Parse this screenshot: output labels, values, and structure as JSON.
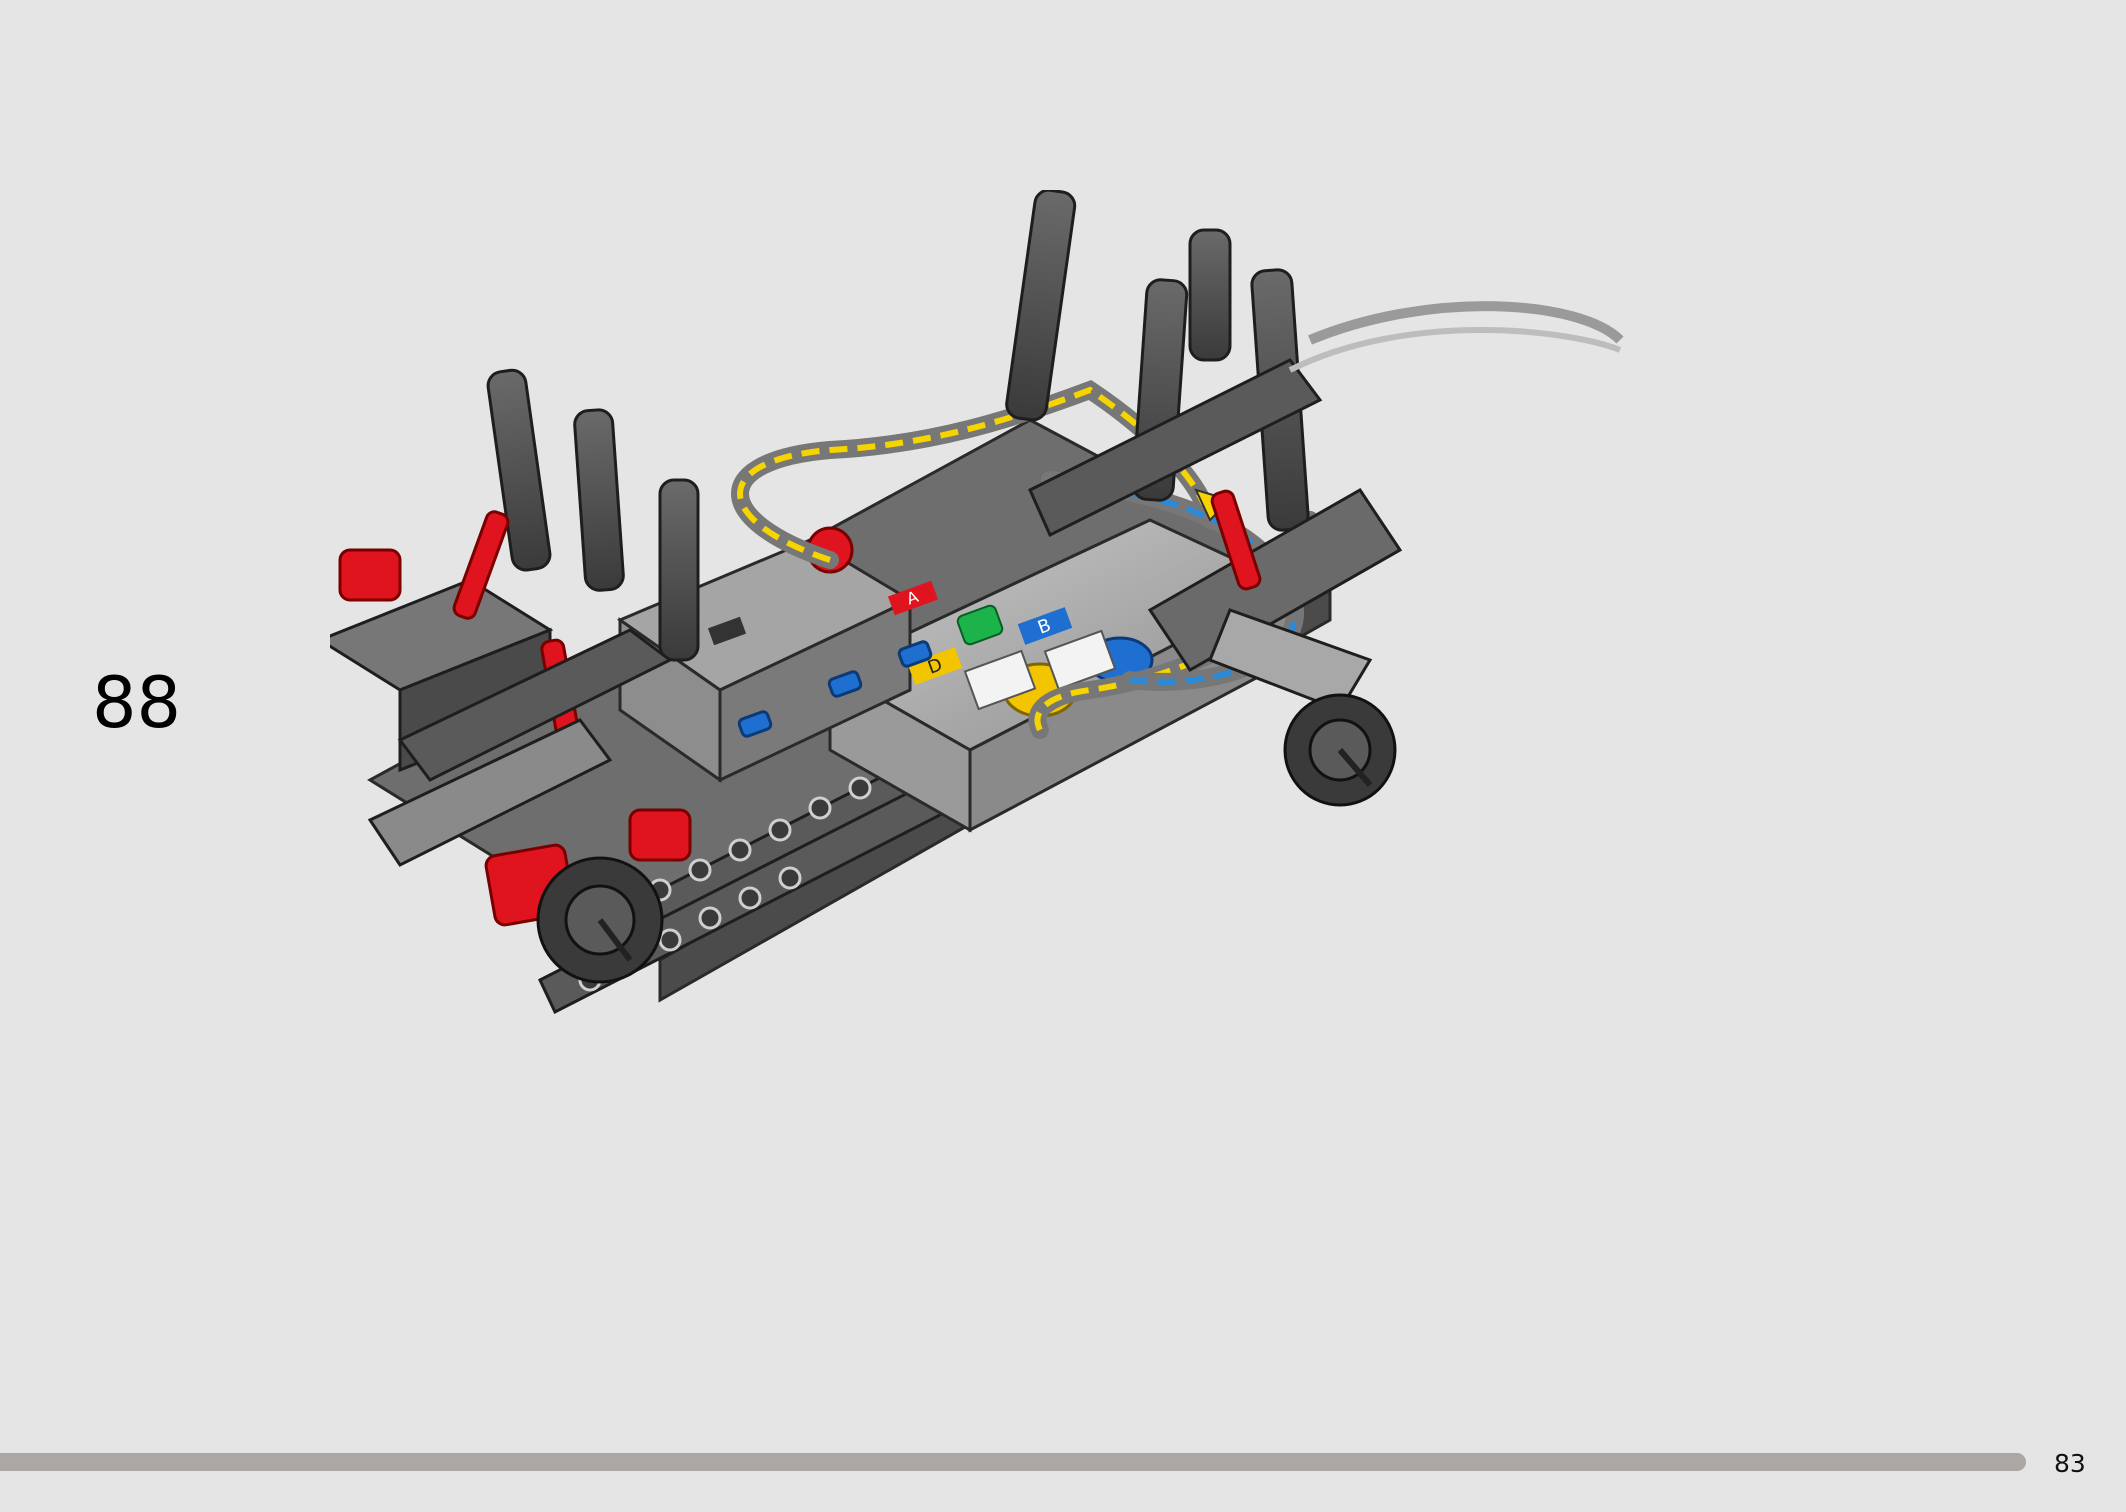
{
  "step": {
    "number": "88"
  },
  "page": {
    "number": "83",
    "progress": 0.976
  },
  "illustration": {
    "subject": "technic-chassis-assembly",
    "hub_port_labels": [
      "A",
      "B",
      "D"
    ],
    "colors": {
      "frame_dark": "#4a4a4a",
      "frame_medium": "#7d7d7d",
      "hub_body": "#a9a9a9",
      "accent_red": "#e0141e",
      "connector_blue": "#1e6fd0",
      "connector_yellow": "#f2c500",
      "hub_button_green": "#1cb34a",
      "route_arrow_yellow": "#f5d400",
      "route_arrow_blue": "#2a8ad8"
    }
  }
}
